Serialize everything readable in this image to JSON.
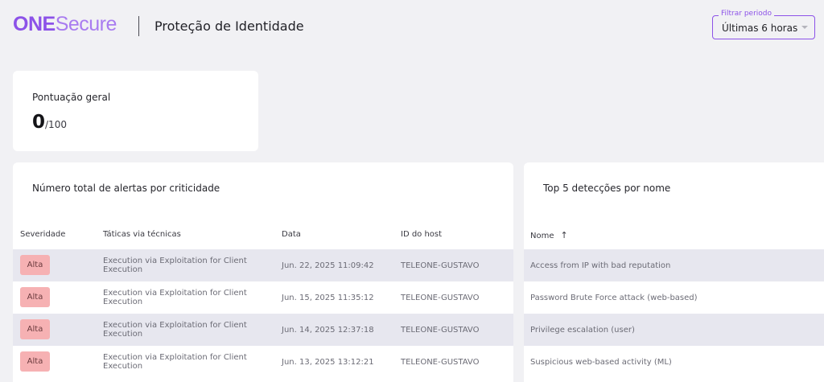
{
  "header": {
    "logo_one": "ONE",
    "logo_secure": "Secure",
    "page_title": "Proteção de Identidade",
    "filter": {
      "legend": "Filtrar periodo",
      "value": "Últimas 6 horas"
    }
  },
  "score": {
    "label": "Pontuação geral",
    "value": "0",
    "max": "/100"
  },
  "alerts": {
    "title": "Número total de alertas por criticidade",
    "columns": [
      "Severidade",
      "Táticas via técnicas",
      "Data",
      "ID do host"
    ],
    "rows": [
      {
        "severity": "Alta",
        "tactic_line1": "Execution via Exploitation for Client",
        "tactic_line2": "Execution",
        "date": "Jun. 22, 2025 11:09:42",
        "host": "TELEONE-GUSTAVO"
      },
      {
        "severity": "Alta",
        "tactic_line1": "Execution via Exploitation for Client",
        "tactic_line2": "Execution",
        "date": "Jun. 15, 2025 11:35:12",
        "host": "TELEONE-GUSTAVO"
      },
      {
        "severity": "Alta",
        "tactic_line1": "Execution via Exploitation for Client",
        "tactic_line2": "Execution",
        "date": "Jun. 14, 2025 12:37:18",
        "host": "TELEONE-GUSTAVO"
      },
      {
        "severity": "Alta",
        "tactic_line1": "Execution via Exploitation for Client",
        "tactic_line2": "Execution",
        "date": "Jun. 13, 2025 13:12:21",
        "host": "TELEONE-GUSTAVO"
      }
    ]
  },
  "top5": {
    "title": "Top 5 detecções por nome",
    "column": "Nome",
    "sort_icon": "arrow-up-icon",
    "rows": [
      "Access from IP with bad reputation",
      "Password Brute Force attack (web-based)",
      "Privilege escalation (user)",
      "Suspicious web-based activity (ML)"
    ]
  },
  "colors": {
    "brand": "#8c52e8",
    "brand_secure": "#a97cf0",
    "badge_high": "#f6b1b3",
    "row_shade": "#e7e7ef",
    "background": "#f1f1f4"
  }
}
